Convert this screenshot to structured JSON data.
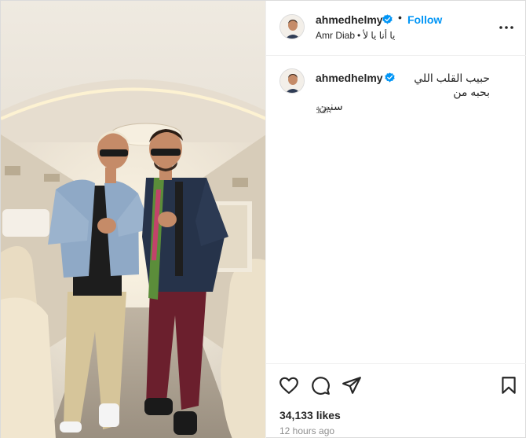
{
  "post": {
    "author": {
      "username": "ahmedhelmy",
      "verified": true,
      "avatar": "avatar-photo"
    },
    "follow_label": "Follow",
    "separator": "•",
    "audio": {
      "artist": "Amr Diab",
      "track": "يا أنا يا لأ"
    },
    "more_icon": "more-horizontal-icon",
    "caption": {
      "username": "ahmedhelmy",
      "line1": "حبيب القلب اللي بحبه من",
      "line2": "سنين.",
      "age": "12h"
    },
    "actions": {
      "like_icon": "heart-icon",
      "comment_icon": "comment-icon",
      "share_icon": "share-icon",
      "save_icon": "bookmark-icon"
    },
    "likes": "34,133 likes",
    "posted": "12 hours ago"
  },
  "colors": {
    "link_blue": "#0095f6",
    "verified_blue": "#0095f6",
    "text": "#262626",
    "muted": "#8e8e8e"
  }
}
